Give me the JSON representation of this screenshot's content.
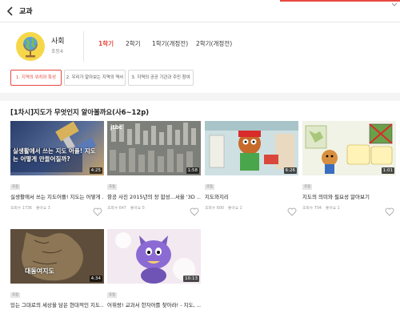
{
  "topbar": {
    "title": "교과",
    "accent_color": "#e8483f"
  },
  "header": {
    "subject": "사회",
    "grade": "초등4"
  },
  "semester_tabs": [
    "1학기",
    "2학기",
    "1학기(개정전)",
    "2학기(개정전)"
  ],
  "unit_chips": [
    "1. 지역의 위치와 특성",
    "2. 우리가 알아보는 지역의 역사",
    "3. 지역의 공공 기관과 주민 참여"
  ],
  "lesson": {
    "title": "[1차시]지도가 무엇인지 알아볼까요(사6~12p)"
  },
  "videos": [
    {
      "tag": "초등",
      "duration": "4:25",
      "title": "실생활에서 쓰는 지도어플! 지도는 어떻게 ...",
      "views": "조회수 1736",
      "likes": "좋아요 3",
      "caption": "실생활에서 쓰는 지도 어플! 지도는 어떻게 만들어질까?"
    },
    {
      "tag": "초등",
      "duration": "1:58",
      "title": "항공 사진 2015년의 장 합성...서울 '3D ...",
      "views": "조회수 647",
      "likes": "좋아요 0",
      "logo": "jtbc"
    },
    {
      "tag": "초등",
      "duration": "6:26",
      "title": "지도와지리",
      "views": "조회수 600",
      "likes": "좋아요 1"
    },
    {
      "tag": "초등",
      "duration": "1:01",
      "title": "지도의 의미와 필요성 알아보기",
      "views": "조회수 704",
      "likes": "좋아요 1"
    },
    {
      "tag": "초등",
      "duration": "4:34",
      "title": "있는 그대로의 세상을 담은 현대적인 지도...",
      "views": "",
      "likes": "",
      "caption": "대동여지도"
    },
    {
      "tag": "초등",
      "duration": "10:13",
      "title": "어휘랑! 교과서 한자어를 찾아라! - 지도, ...",
      "views": "",
      "likes": ""
    }
  ]
}
